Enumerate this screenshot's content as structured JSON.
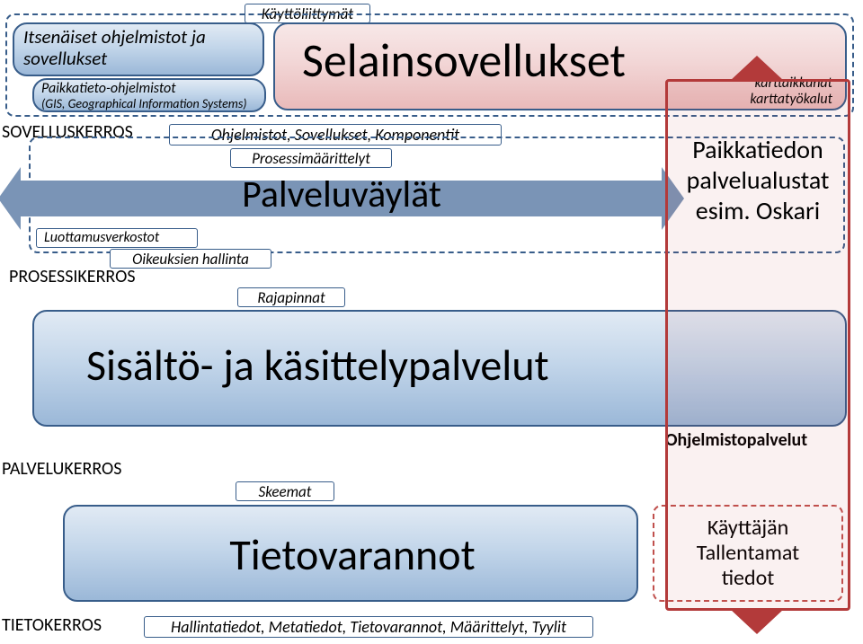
{
  "top": {
    "ui_label": "Käyttöliittymät",
    "standalone_title": "Itsenäiset ohjelmistot ja sovellukset",
    "gis_title": "Paikkatieto-ohjelmistot",
    "gis_sub": "(GIS, Geographical Information Systems)",
    "browser_apps": "Selainsovellukset",
    "map_windows": "karttaikkunat",
    "map_tools": "karttatyökalut"
  },
  "appLayer": {
    "name": "SOVELLUSKERROS",
    "apps_label": "Ohjelmistot, Sovellukset, Komponentit"
  },
  "process": {
    "proc_defs": "Prosessimäärittelyt",
    "service_bus": "Palveluväylät",
    "trust_nets": "Luottamusverkostot",
    "rights": "Oikeuksien hallinta",
    "name": "PROSESSIKERROS",
    "interfaces": "Rajapinnat"
  },
  "right": {
    "platform_l1": "Paikkatiedon",
    "platform_l2": "palvelualustat",
    "platform_l3": "esim. Oskari"
  },
  "services": {
    "big": "Sisältö- ja käsittelypalvelut",
    "sw_services": "Ohjelmistopalvelut",
    "name": "PALVELUKERROS",
    "schemas": "Skeemat"
  },
  "data": {
    "repos": "Tietovarannot",
    "user_saved_l1": "Käyttäjän",
    "user_saved_l2": "Tallentamat",
    "user_saved_l3": "tiedot",
    "name": "TIETOKERROS",
    "meta": "Hallintatiedot, Metatiedot, Tietovarannot, Määrittelyt, Tyylit"
  }
}
